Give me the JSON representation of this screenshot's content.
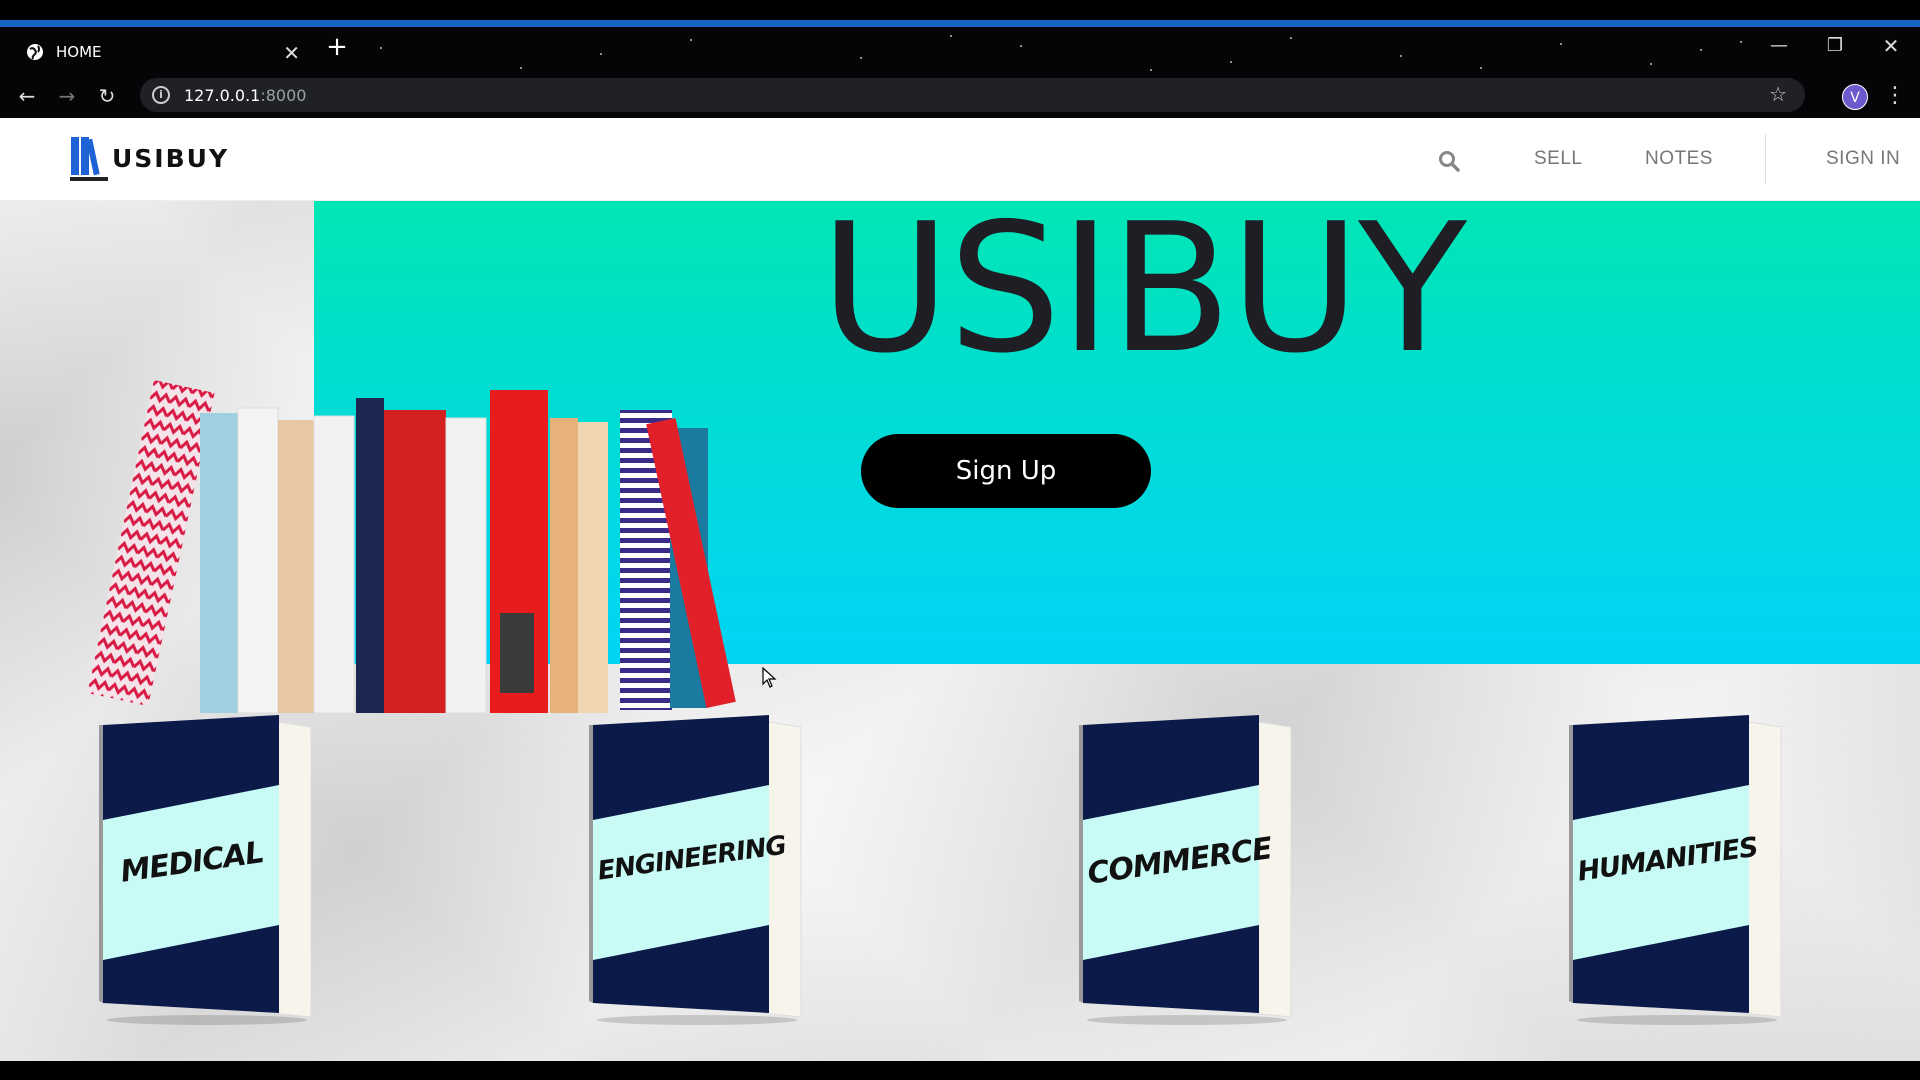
{
  "browser": {
    "tab_title": "HOME",
    "new_tab_symbol": "+",
    "url_host": "127.0.0.1",
    "url_port": ":8000",
    "profile_initial": "V",
    "icons": [
      "globe-icon",
      "close-icon",
      "back-icon",
      "forward-icon",
      "reload-icon",
      "info-icon",
      "star-icon",
      "minimize-icon",
      "restore-icon",
      "close-window-icon",
      "kebab-menu-icon"
    ]
  },
  "site": {
    "brand": "USIBUY",
    "nav": {
      "sell": "SELL",
      "notes": "NOTES",
      "sign_in": "SIGN IN"
    },
    "hero": {
      "title": "USIBUY",
      "cta": "Sign Up"
    },
    "categories": [
      {
        "label": "MEDICAL"
      },
      {
        "label": "ENGINEERING"
      },
      {
        "label": "COMMERCE"
      },
      {
        "label": "HUMANITIES"
      }
    ]
  },
  "colors": {
    "accent_bar": "#1565c0",
    "hero_top": "#00e6b4",
    "hero_bottom": "#00d4f5",
    "book_cover_dark": "#0c1a4a",
    "book_band": "#c8fbf6"
  }
}
